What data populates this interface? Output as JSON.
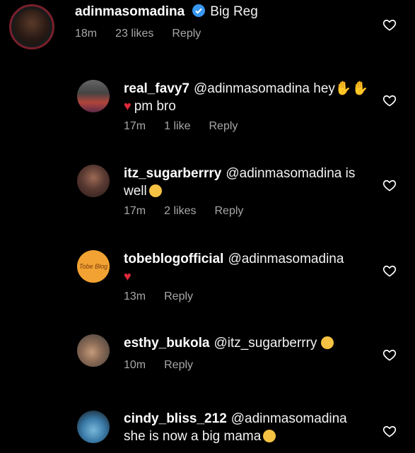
{
  "main_comment": {
    "username": "adinmasomadina",
    "text": "Big Reg",
    "time": "18m",
    "likes": "23 likes",
    "reply": "Reply"
  },
  "replies": [
    {
      "username": "real_favy7",
      "mention": "@adinmasomadina",
      "text_a": "hey",
      "text_b": "pm bro",
      "time": "17m",
      "likes": "1 like",
      "reply": "Reply"
    },
    {
      "username": "itz_sugarberrry",
      "mention": "@adinmasomadina",
      "text_a": "is",
      "text_b": "well",
      "time": "17m",
      "likes": "2 likes",
      "reply": "Reply"
    },
    {
      "username": "tobeblogofficial",
      "mention": "@adinmasomadina",
      "avatar_text": "Tobe Blog",
      "time": "13m",
      "reply": "Reply"
    },
    {
      "username": "esthy_bukola",
      "mention": "@itz_sugarberrry",
      "time": "10m",
      "reply": "Reply"
    },
    {
      "username": "cindy_bliss_212",
      "mention": "@adinmasomadina",
      "text_b": "she is now a big mama"
    }
  ],
  "colors": {
    "background": "#000000",
    "meta_text": "#a8a8a8",
    "heart_red": "#e0283a",
    "verified_blue": "#3897f0"
  }
}
